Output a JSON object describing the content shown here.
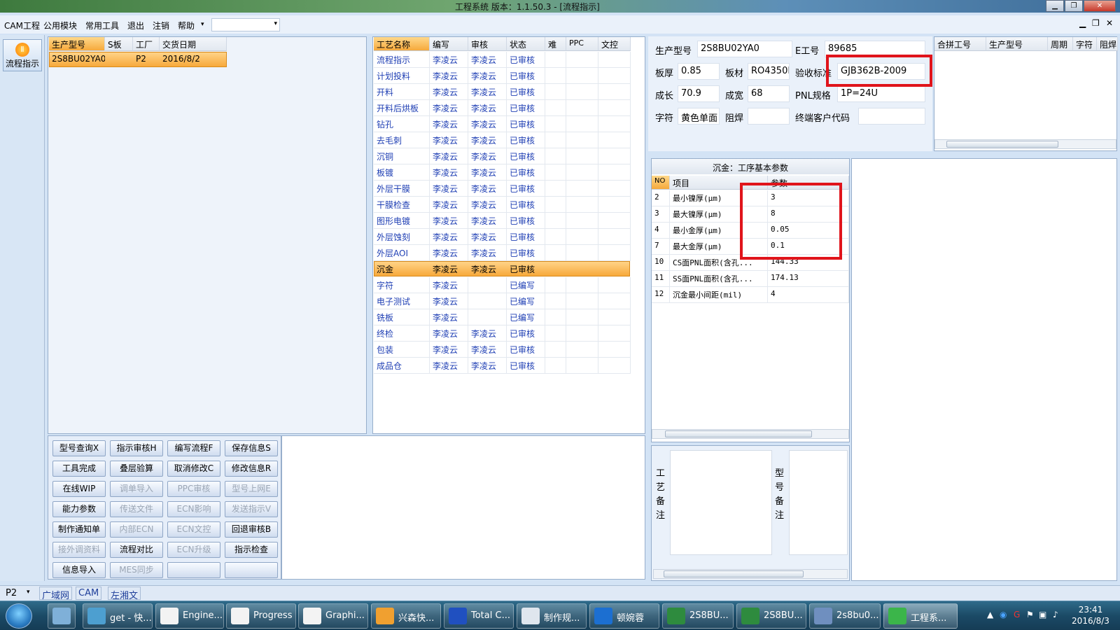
{
  "window": {
    "title": "工程系统   版本：1.1.50.3 - [流程指示]",
    "min": "▁",
    "max": "❐",
    "close": "✕"
  },
  "menu": {
    "items": [
      "CAM工程",
      "公用模块",
      "常用工具",
      "退出",
      "注销",
      "帮助"
    ],
    "help_arrow": "▾",
    "combo_value": "",
    "combo_arrow": "▾",
    "mdi_controls": [
      "▁",
      "❐",
      "✕"
    ]
  },
  "sidebar": {
    "flow_button_label": "流程指示"
  },
  "orders": {
    "headers": [
      "生产型号",
      "S板",
      "工厂",
      "交货日期"
    ],
    "rows": [
      [
        "2S8BU02YA0",
        "",
        "P2",
        "2016/8/2"
      ]
    ]
  },
  "process": {
    "headers": [
      "工艺名称",
      "编写",
      "审核",
      "状态",
      "难",
      "PPC",
      "文控"
    ],
    "selected_index": 13,
    "rows": [
      [
        "流程指示",
        "李凌云",
        "李凌云",
        "已审核"
      ],
      [
        "计划投料",
        "李凌云",
        "李凌云",
        "已审核"
      ],
      [
        "开料",
        "李凌云",
        "李凌云",
        "已审核"
      ],
      [
        "开料后烘板",
        "李凌云",
        "李凌云",
        "已审核"
      ],
      [
        "钻孔",
        "李凌云",
        "李凌云",
        "已审核"
      ],
      [
        "去毛刺",
        "李凌云",
        "李凌云",
        "已审核"
      ],
      [
        "沉铜",
        "李凌云",
        "李凌云",
        "已审核"
      ],
      [
        "板镀",
        "李凌云",
        "李凌云",
        "已审核"
      ],
      [
        "外层干膜",
        "李凌云",
        "李凌云",
        "已审核"
      ],
      [
        "干膜检查",
        "李凌云",
        "李凌云",
        "已审核"
      ],
      [
        "图形电镀",
        "李凌云",
        "李凌云",
        "已审核"
      ],
      [
        "外层蚀刻",
        "李凌云",
        "李凌云",
        "已审核"
      ],
      [
        "外层AOI",
        "李凌云",
        "李凌云",
        "已审核"
      ],
      [
        "沉金",
        "李凌云",
        "李凌云",
        "已审核"
      ],
      [
        "字符",
        "李凌云",
        "",
        "已编写"
      ],
      [
        "电子测试",
        "李凌云",
        "",
        "已编写"
      ],
      [
        "铣板",
        "李凌云",
        "",
        "已编写"
      ],
      [
        "终检",
        "李凌云",
        "李凌云",
        "已审核"
      ],
      [
        "包装",
        "李凌云",
        "李凌云",
        "已审核"
      ],
      [
        "成品仓",
        "李凌云",
        "李凌云",
        "已审核"
      ]
    ]
  },
  "buttons": [
    {
      "label": "型号查询X",
      "enabled": true
    },
    {
      "label": "指示审核H",
      "enabled": true
    },
    {
      "label": "编写流程F",
      "enabled": true
    },
    {
      "label": "保存信息S",
      "enabled": true
    },
    {
      "label": "工具完成",
      "enabled": true
    },
    {
      "label": "叠层验算",
      "enabled": true
    },
    {
      "label": "取消修改C",
      "enabled": true
    },
    {
      "label": "修改信息R",
      "enabled": true
    },
    {
      "label": "在线WIP",
      "enabled": true
    },
    {
      "label": "调单导入",
      "enabled": false
    },
    {
      "label": "PPC审核",
      "enabled": false
    },
    {
      "label": "型号上网E",
      "enabled": false
    },
    {
      "label": "能力参数",
      "enabled": true
    },
    {
      "label": "传送文件",
      "enabled": false
    },
    {
      "label": "ECN影响",
      "enabled": false
    },
    {
      "label": "发送指示V",
      "enabled": false
    },
    {
      "label": "制作通知单",
      "enabled": true
    },
    {
      "label": "内部ECN",
      "enabled": false
    },
    {
      "label": "ECN文控",
      "enabled": false
    },
    {
      "label": "回退审核B",
      "enabled": true
    },
    {
      "label": "接外调资料",
      "enabled": false
    },
    {
      "label": "流程对比",
      "enabled": true
    },
    {
      "label": "ECN升级",
      "enabled": false
    },
    {
      "label": "指示检查",
      "enabled": true
    },
    {
      "label": "信息导入",
      "enabled": true
    },
    {
      "label": "MES同步",
      "enabled": false
    },
    {
      "label": "",
      "enabled": false
    },
    {
      "label": "",
      "enabled": false
    }
  ],
  "info": {
    "model_label": "生产型号",
    "model": "2S8BU02YA0",
    "eno_label": "E工号",
    "eno": "89685",
    "thick_label": "板厚",
    "thick": "0.85",
    "material_label": "板材",
    "material": "RO4350E",
    "standard_label": "验收标准",
    "standard": "GJB362B-2009",
    "len_label": "成长",
    "len": "70.9",
    "wid_label": "成宽",
    "wid": "68",
    "pnl_label": "PNL规格",
    "pnl": "1P=24U",
    "char_label": "字符",
    "char": "黄色单面",
    "mask_label": "阻焊",
    "mask": "",
    "cust_label": "终端客户代码",
    "cust": ""
  },
  "combine": {
    "headers": [
      "合拼工号",
      "生产型号",
      "周期",
      "字符",
      "阻焊"
    ]
  },
  "params": {
    "title": "沉金：工序基本参数",
    "headers": [
      "NO",
      "项目",
      "参数"
    ],
    "rows": [
      [
        "2",
        "最小镍厚(μm)",
        "3"
      ],
      [
        "3",
        "最大镍厚(μm)",
        "8"
      ],
      [
        "4",
        "最小金厚(μm)",
        "0.05"
      ],
      [
        "7",
        "最大金厚(μm)",
        "0.1"
      ],
      [
        "10",
        "CS面PNL面积(含孔...",
        "144.33"
      ],
      [
        "11",
        "SS面PNL面积(含孔...",
        "174.13"
      ],
      [
        "12",
        "沉金最小间距(mil)",
        "4"
      ]
    ]
  },
  "notes": {
    "process_note_label": "工艺备注",
    "model_note_label": "型号备注"
  },
  "status": {
    "factory": "P2",
    "arrow": "▾",
    "items": [
      "广域网",
      "CAM",
      "左湘文"
    ]
  },
  "taskbar": {
    "items": [
      {
        "label": "",
        "color": "#7fb0d8"
      },
      {
        "label": "get - 快...",
        "color": "#4d9fd0"
      },
      {
        "label": "Engine...",
        "color": "#f3f3f3"
      },
      {
        "label": "Progress",
        "color": "#f3f3f3"
      },
      {
        "label": "Graphi...",
        "color": "#f3f3f3"
      },
      {
        "label": "兴森快...",
        "color": "#f0a030"
      },
      {
        "label": "Total C...",
        "color": "#2050c0"
      },
      {
        "label": "制作规...",
        "color": "#dfe6ee"
      },
      {
        "label": "顿婉蓉",
        "color": "#1c6fd1"
      },
      {
        "label": "2S8BU...",
        "color": "#2e8b3e"
      },
      {
        "label": "2S8BU...",
        "color": "#2e8b3e"
      },
      {
        "label": "2s8bu0...",
        "color": "#6f8fbf"
      },
      {
        "label": "工程系...",
        "color": "#3bb54a"
      }
    ],
    "time": "23:41",
    "date": "2016/8/3"
  }
}
